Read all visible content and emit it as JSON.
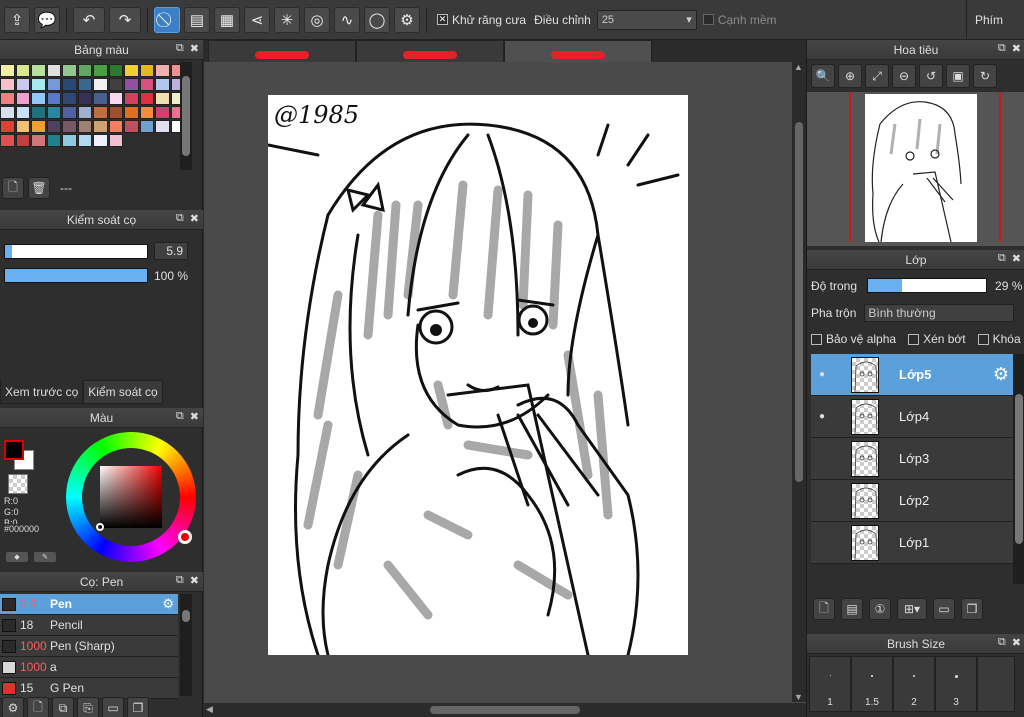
{
  "toolbar": {
    "antialias_label": "Khử răng cưa",
    "adjust_label": "Điều chỉnh",
    "adjust_value": "25",
    "soft_edge_label": "Cạnh mềm",
    "right_label": "Phím"
  },
  "palette": {
    "title": "Bảng màu",
    "empty_label": "---",
    "colors": [
      "#f0f0a0",
      "#d8e890",
      "#b8e0a0",
      "#e0e0e0",
      "#90c890",
      "#60a860",
      "#48a040",
      "#2c7a30",
      "#f0d030",
      "#e8b820",
      "#f0b0b0",
      "#f09090",
      "#f8c0c8",
      "#c8c8f0",
      "#a8e8f0",
      "#7898d8",
      "#284878",
      "#386890",
      "#f0f0f0",
      "#404040",
      "#9050a0",
      "#d85080",
      "#b0c8f0",
      "#c0b0e0",
      "#f08080",
      "#f0a0d0",
      "#90c8f8",
      "#5878c8",
      "#304878",
      "#383058",
      "#486090",
      "#f8d8f0",
      "#d04060",
      "#e03040",
      "#f0e0b0",
      "#f0f0c8",
      "#d8e0f0",
      "#c8e0f8",
      "#207080",
      "#2888a0",
      "#5060a0",
      "#a0b0d0",
      "#c07040",
      "#a05030",
      "#e07020",
      "#f09040",
      "#d04070",
      "#f07090",
      "#e04030",
      "#f0c070",
      "#f0a030",
      "#504060",
      "#785868",
      "#a08070",
      "#d0a070",
      "#f08060",
      "#c05060",
      "#70a0d0",
      "#e0e0f0",
      "#ffffff",
      "#e05050",
      "#c04040",
      "#d07878",
      "#208090",
      "#90c8e0",
      "#b0d8f0",
      "#f0f0ff",
      "#f0c0d0"
    ]
  },
  "brush_control": {
    "title": "Kiểm soát cọ",
    "size_value": "5.9",
    "size_fraction": 0.05,
    "opacity_value": "100 %",
    "opacity_fraction": 1.0,
    "tab_preview": "Xem trước cọ",
    "tab_control": "Kiểm soát cọ"
  },
  "color": {
    "title": "Màu",
    "fg": "#000000",
    "r_label": "R:0",
    "g_label": "G:0",
    "b_label": "B:0",
    "hex_label": "#000000"
  },
  "brushes": {
    "title": "Cọ: Pen",
    "items": [
      {
        "size": "5.9",
        "name": "Pen",
        "swatch": "#2a2a2a",
        "size_red": true,
        "active": true
      },
      {
        "size": "18",
        "name": "Pencil",
        "swatch": "#2a2a2a",
        "size_red": false,
        "active": false
      },
      {
        "size": "1000",
        "name": "Pen (Sharp)",
        "swatch": "#2a2a2a",
        "size_red": true,
        "active": false
      },
      {
        "size": "1000",
        "name": "a",
        "swatch": "#d8d8d8",
        "size_red": true,
        "active": false
      },
      {
        "size": "15",
        "name": "G Pen",
        "swatch": "#e03030",
        "size_red": false,
        "active": false
      }
    ]
  },
  "canvas": {
    "signature": "@1985"
  },
  "navigator": {
    "title": "Hoa tiêu"
  },
  "layers": {
    "title": "Lớp",
    "opacity_label": "Độ trong",
    "opacity_value": "29 %",
    "opacity_fraction": 0.29,
    "blend_label": "Pha trộn",
    "blend_value": "Bình thường",
    "protect_alpha": "Bảo vệ alpha",
    "clipping": "Xén bớt",
    "lock": "Khóa",
    "items": [
      {
        "name": "Lớp5",
        "active": true,
        "visible": true
      },
      {
        "name": "Lớp4",
        "active": false,
        "visible": true
      },
      {
        "name": "Lớp3",
        "active": false,
        "visible": false
      },
      {
        "name": "Lớp2",
        "active": false,
        "visible": false
      },
      {
        "name": "Lớp1",
        "active": false,
        "visible": false
      }
    ]
  },
  "brush_size": {
    "title": "Brush Size",
    "sizes": [
      "1",
      "1.5",
      "2",
      "3"
    ]
  }
}
